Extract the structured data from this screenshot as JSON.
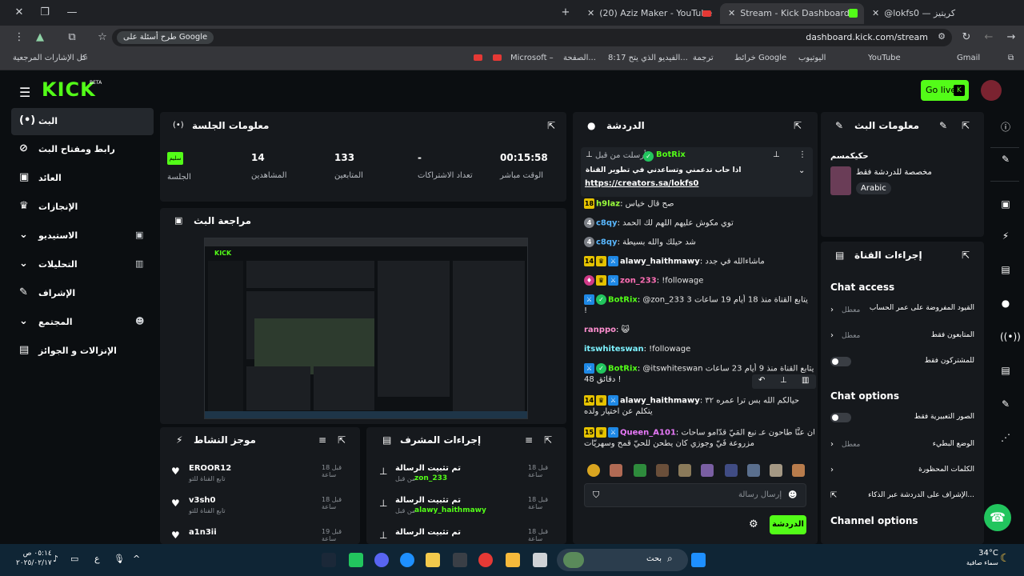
{
  "browser": {
    "tabs": [
      {
        "title": "(20) Aziz Maker - YouTube"
      },
      {
        "title": "Stream - Kick Dashboard"
      },
      {
        "title": "@lokfs0 — كريتيز"
      }
    ],
    "url": "dashboard.kick.com/stream",
    "google_chip": "طرح أسئلة على Google",
    "bookmarks": {
      "all_bookmarks": "كل الإشارات المرجعية",
      "items": [
        "Microsoft –",
        "الصفحة...",
        "8:17 الفيديو الذي يتح...",
        "ترجمة",
        "خرائط Google",
        "اليوتيوب",
        "YouTube",
        "Gmail"
      ]
    }
  },
  "header": {
    "logo": "KICK",
    "logo_beta": "BETA",
    "go_live": "Go live"
  },
  "sidebar": {
    "items": [
      {
        "label": "البث"
      },
      {
        "label": "رابط ومفتاح البث"
      },
      {
        "label": "العائد"
      },
      {
        "label": "الإنجازات"
      },
      {
        "label": "الاستيديو"
      },
      {
        "label": "التحليلات"
      },
      {
        "label": "الإشراف"
      },
      {
        "label": "المجتمع"
      },
      {
        "label": "الإنزالات و الجوائز"
      }
    ]
  },
  "session": {
    "title": "معلومات الجلسة",
    "status": "سليم",
    "status_label": "الجلسة",
    "stats": [
      {
        "value": "14",
        "label": "المشاهدين"
      },
      {
        "value": "133",
        "label": "المتابعين"
      },
      {
        "value": "-",
        "label": "تعداد الاشتراكات"
      },
      {
        "value": "00:15:58",
        "label": "الوقت مباشر"
      }
    ]
  },
  "preview": {
    "title": "مراجعة البث"
  },
  "activity": {
    "title": "موجز النشاط",
    "items": [
      {
        "user": "EROOR12",
        "desc": "تابع القناة للتو",
        "time": "قبل 18 ساعة"
      },
      {
        "user": "v3sh0",
        "desc": "تابع القناة للتو",
        "time": "قبل 18 ساعة"
      },
      {
        "user": "a1n3ii",
        "desc": "",
        "time": "قبل 19 ساعة"
      }
    ]
  },
  "mod_actions": {
    "title": "إجراءات المشرف",
    "items": [
      {
        "action": "تم تثبيت الرسالة",
        "by": "zon_233",
        "by_prefix": "من قبل",
        "time": "قبل 18 ساعة"
      },
      {
        "action": "تم تثبيت الرسالة",
        "by": "alawy_haithmawy",
        "by_prefix": "من قبل",
        "time": "قبل 18 ساعة"
      },
      {
        "action": "تم تثبيت الرسالة",
        "by": "",
        "by_prefix": "",
        "time": "قبل 18 ساعة"
      }
    ]
  },
  "chat": {
    "title": "الدردشة",
    "pinned": {
      "header": "أرسلت من قبل",
      "user": "BotRix",
      "text": "اذا حاب تدعمني وتساعدني في تطوير القناة",
      "link": "https://creators.sa/lokfs0"
    },
    "messages": [
      {
        "badge": "18",
        "user": "h9laz",
        "text": "صح قال خياس"
      },
      {
        "badge": "4",
        "user": "c8qy",
        "text": "توي مكوش عليهم اللهم لك الحمد"
      },
      {
        "badge": "4",
        "user": "c8qy",
        "text": "شد حيلك والله بسيطة"
      },
      {
        "badge": "14",
        "user": "alawy_haithmawy",
        "text": "ماشاءالله في جدد"
      },
      {
        "badge": "",
        "user": "zon_233",
        "text": "!followage"
      },
      {
        "badge": "",
        "user": "BotRix",
        "text": "@zon_233 يتابع القناة منذ 18 أيام 19 ساعات 3"
      },
      {
        "badge": "",
        "user": "BotRix_cont",
        "text": "!"
      },
      {
        "badge": "",
        "user": "ranppo",
        "text": ""
      },
      {
        "badge": "",
        "user": "itswhiteswan",
        "text": "!followage"
      },
      {
        "badge": "",
        "user": "BotRix",
        "text": "@itswhiteswan يتابع القناة منذ 9 أيام 23 ساعات"
      },
      {
        "badge": "",
        "user": "",
        "text": "48 دقائق !"
      },
      {
        "badge": "14",
        "user": "alawy_haithmawy",
        "text": "حيالكم الله بس ترا عمره ٣٢"
      },
      {
        "badge": "",
        "user": "",
        "text": "يتكلم عن اختيار ولده"
      },
      {
        "badge": "15",
        "user": "Queen_A101",
        "text": "كان عنَّا طاحون عـ نبع المَيّ قدّامو ساحات"
      },
      {
        "badge": "",
        "user": "",
        "text": "مزروعة فَيّ وجوزي كان يطحن للحيّ قمح وسهريّات"
      }
    ],
    "input_placeholder": "إرسال رسالة",
    "send_button": "الدردشة"
  },
  "stream_info": {
    "title": "معلومات البث",
    "stream_title": "حكيكمسم",
    "subtitle": "مخصصة للدردشة فقط",
    "language_tag": "Arabic"
  },
  "channel_actions": {
    "title": "إجراءات القناة",
    "chat_access": {
      "heading": "Chat access",
      "rows": [
        {
          "label": "القيود المفروضة على عمر الحساب",
          "value": "معطل"
        },
        {
          "label": "المتابعون فقط",
          "value": "معطل"
        },
        {
          "label": "للمشتركون فقط",
          "value": ""
        }
      ]
    },
    "chat_options": {
      "heading": "Chat options",
      "rows": [
        {
          "label": "الصور التعبيرية فقط",
          "value": ""
        },
        {
          "label": "الوضع البطيء",
          "value": "معطل"
        },
        {
          "label": "الكلمات المحظورة",
          "value": ""
        },
        {
          "label": "الإشراف على الدردشة عبر الذكاء...",
          "value": ""
        }
      ]
    },
    "channel_options": {
      "heading": "Channel options"
    }
  },
  "taskbar": {
    "search": "بحث",
    "weather_temp": "34°C",
    "weather_desc": "سماء صافية",
    "time": "٠٥:١٤ ص",
    "date": "٢٠٢٥/٠٢/١٧",
    "lang": "ع"
  },
  "colors": {
    "accent": "#53fc18",
    "bg": "#0b0e11",
    "panel": "#16191d"
  }
}
